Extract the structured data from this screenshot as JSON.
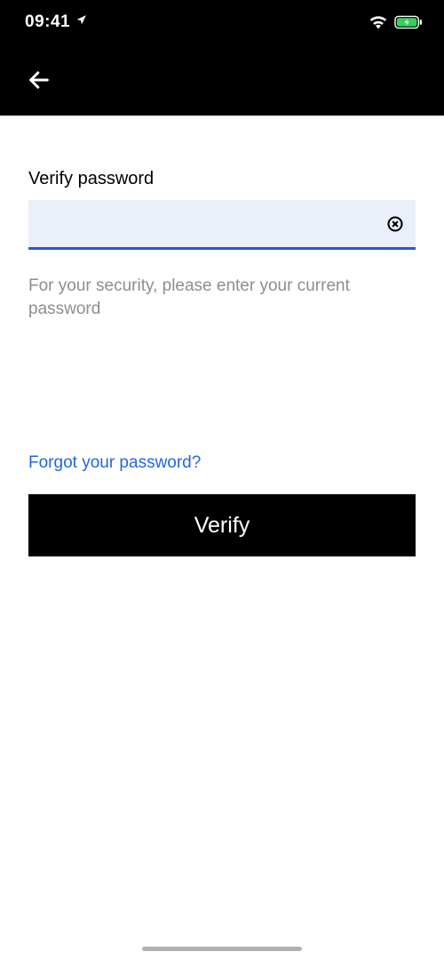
{
  "status": {
    "time": "09:41"
  },
  "field": {
    "label": "Verify password",
    "value": "",
    "helper": "For your security, please enter your current password"
  },
  "links": {
    "forgot": "Forgot your password?"
  },
  "buttons": {
    "verify": "Verify"
  }
}
